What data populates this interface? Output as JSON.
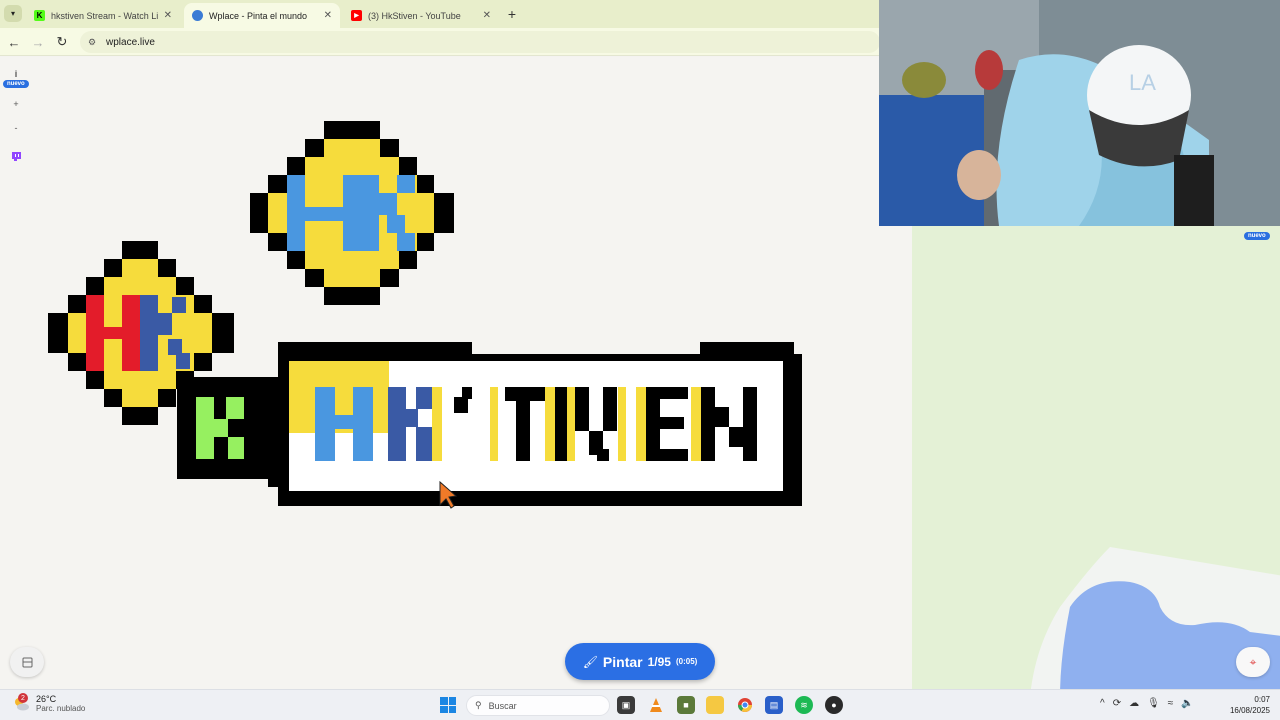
{
  "browser": {
    "tabs": [
      {
        "label": "hkstiven Stream - Watch Live o",
        "favicon": "kick-icon",
        "color": "#53fc18",
        "active": false
      },
      {
        "label": "Wplace - Pinta el mundo",
        "favicon": "globe-icon",
        "color": "#3a7bd5",
        "active": true
      },
      {
        "label": "(3) HkStiven - YouTube",
        "favicon": "youtube-icon",
        "color": "#ff0000",
        "active": false
      }
    ],
    "new_tab_label": "+",
    "address": "wplace.live"
  },
  "canvas": {
    "left_tools": {
      "info_icon": "i",
      "new_badge": "nuevo",
      "zoom_in": "+",
      "zoom_out": "-",
      "twitch_icon": "twitch-icon"
    },
    "right_badge": "nuevo",
    "pixel_art_text": "HK'STIVEN",
    "paint_button": {
      "label": "Pintar",
      "count": "1/95",
      "timer": "(0:05)"
    }
  },
  "taskbar": {
    "weather": {
      "temp": "26°C",
      "condition": "Parc. nublado",
      "alert_count": "2"
    },
    "search_placeholder": "Buscar",
    "apps": [
      "task-view",
      "vlc",
      "minecraft",
      "file-explorer",
      "chrome",
      "store",
      "spotify",
      "obs"
    ],
    "clock": {
      "time": "0:07",
      "date": "16/08/2025"
    }
  },
  "colors": {
    "accent": "#2b6fe4",
    "yellow": "#f6dc3c",
    "blue": "#4a97e0",
    "darkblue": "#3a5aa5",
    "red": "#e31c2a",
    "green": "#96f060",
    "black": "#000000"
  }
}
